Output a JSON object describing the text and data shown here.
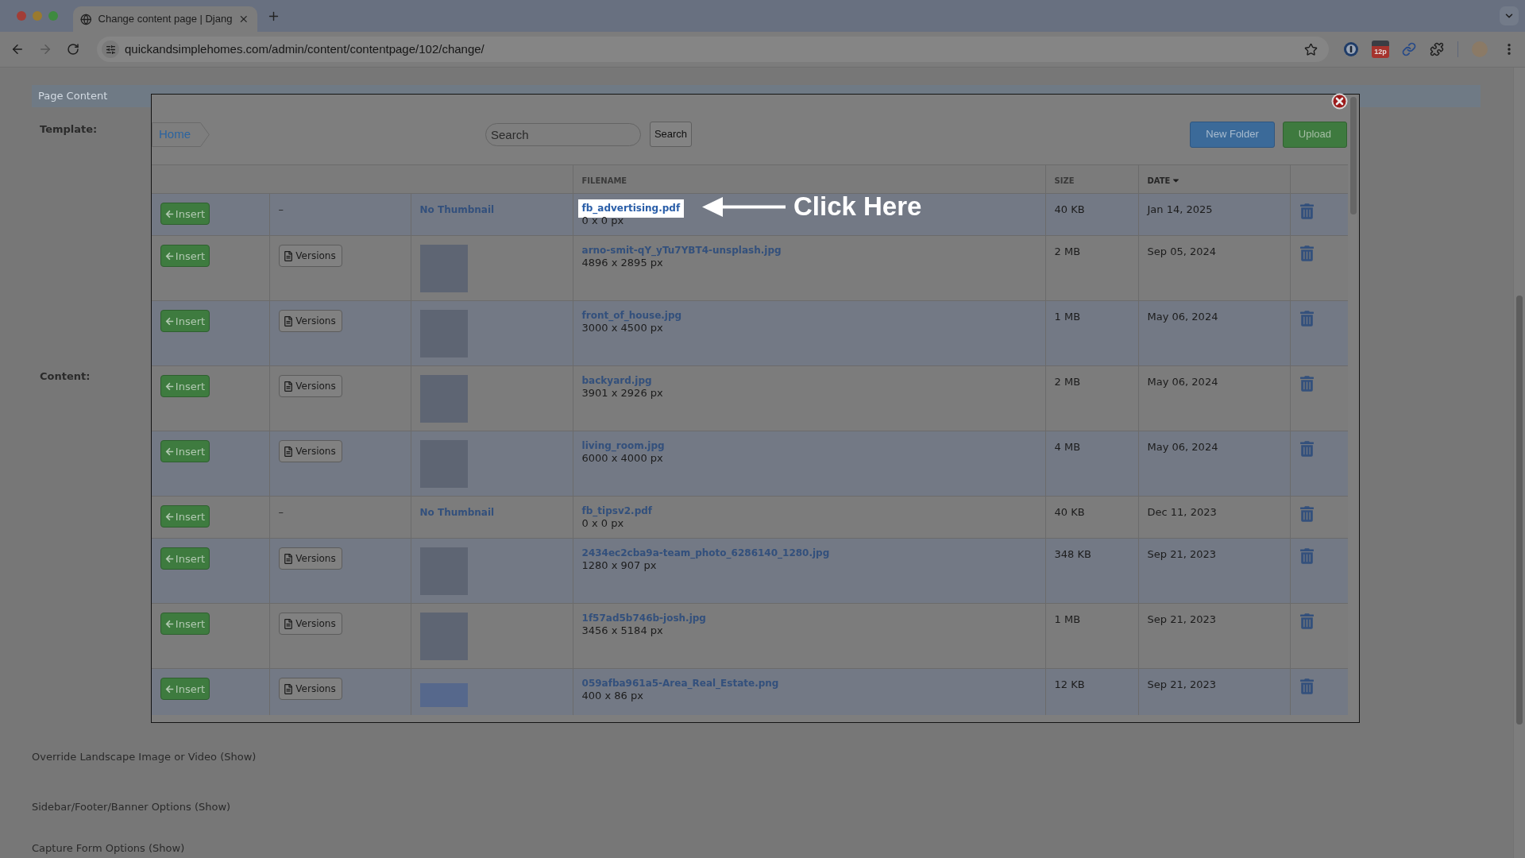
{
  "browser": {
    "tab": {
      "title": "Change content page | Djang"
    },
    "url": "quickandsimplehomes.com/admin/content/contentpage/102/change/",
    "extension_badge": "12p"
  },
  "page": {
    "panel_title": "Page Content",
    "fields": [
      {
        "label": "Template:"
      },
      {
        "label": "Content:"
      }
    ],
    "sections": [
      "Override Landscape Image or Video (Show)",
      "Sidebar/Footer/Banner Options (Show)",
      "Capture Form Options (Show)"
    ]
  },
  "dialog": {
    "breadcrumb": [
      {
        "label": "Home"
      }
    ],
    "search": {
      "placeholder": "Search",
      "button": "Search"
    },
    "actions": [
      {
        "kind": "primary",
        "label": "New Folder"
      },
      {
        "kind": "success",
        "label": "Upload"
      }
    ],
    "columns": [
      {
        "label": "FILENAME",
        "sorted": false
      },
      {
        "label": "SIZE",
        "sorted": false
      },
      {
        "label": "DATE",
        "sorted": true
      }
    ],
    "rows": [
      {
        "insert": "Insert",
        "versions": {
          "kind": "dash",
          "text": "–"
        },
        "thumbnail": {
          "kind": "none",
          "text": "No Thumbnail"
        },
        "filename": "fb_advertising.pdf",
        "dimensions": "0 x 0 px",
        "size": "40 KB",
        "date": "Jan 14, 2025",
        "highlighted": true
      },
      {
        "insert": "Insert",
        "versions": {
          "kind": "button",
          "label": "Versions"
        },
        "thumbnail": {
          "kind": "photo"
        },
        "filename": "arno-smit-qY_yTu7YBT4-unsplash.jpg",
        "dimensions": "4896 x 2895 px",
        "size": "2 MB",
        "date": "Sep 05, 2024",
        "highlighted": false
      },
      {
        "insert": "Insert",
        "versions": {
          "kind": "button",
          "label": "Versions"
        },
        "thumbnail": {
          "kind": "photo"
        },
        "filename": "front_of_house.jpg",
        "dimensions": "3000 x 4500 px",
        "size": "1 MB",
        "date": "May 06, 2024",
        "highlighted": false
      },
      {
        "insert": "Insert",
        "versions": {
          "kind": "button",
          "label": "Versions"
        },
        "thumbnail": {
          "kind": "photo"
        },
        "filename": "backyard.jpg",
        "dimensions": "3901 x 2926 px",
        "size": "2 MB",
        "date": "May 06, 2024",
        "highlighted": false
      },
      {
        "insert": "Insert",
        "versions": {
          "kind": "button",
          "label": "Versions"
        },
        "thumbnail": {
          "kind": "photo"
        },
        "filename": "living_room.jpg",
        "dimensions": "6000 x 4000 px",
        "size": "4 MB",
        "date": "May 06, 2024",
        "highlighted": false
      },
      {
        "insert": "Insert",
        "versions": {
          "kind": "dash",
          "text": "–"
        },
        "thumbnail": {
          "kind": "none",
          "text": "No Thumbnail"
        },
        "filename": "fb_tipsv2.pdf",
        "dimensions": "0 x 0 px",
        "size": "40 KB",
        "date": "Dec 11, 2023",
        "highlighted": false
      },
      {
        "insert": "Insert",
        "versions": {
          "kind": "button",
          "label": "Versions"
        },
        "thumbnail": {
          "kind": "photo"
        },
        "filename": "2434ec2cba9a-team_photo_6286140_1280.jpg",
        "dimensions": "1280 x 907 px",
        "size": "348 KB",
        "date": "Sep 21, 2023",
        "highlighted": false
      },
      {
        "insert": "Insert",
        "versions": {
          "kind": "button",
          "label": "Versions"
        },
        "thumbnail": {
          "kind": "photo"
        },
        "filename": "1f57ad5b746b-josh.jpg",
        "dimensions": "3456 x 5184 px",
        "size": "1 MB",
        "date": "Sep 21, 2023",
        "highlighted": false
      },
      {
        "insert": "Insert",
        "versions": {
          "kind": "button",
          "label": "Versions"
        },
        "thumbnail": {
          "kind": "logo"
        },
        "filename": "059afba961a5-Area_Real_Estate.png",
        "dimensions": "400 x 86 px",
        "size": "12 KB",
        "date": "Sep 21, 2023",
        "highlighted": false
      }
    ]
  },
  "annotation": {
    "text": "Click Here"
  }
}
